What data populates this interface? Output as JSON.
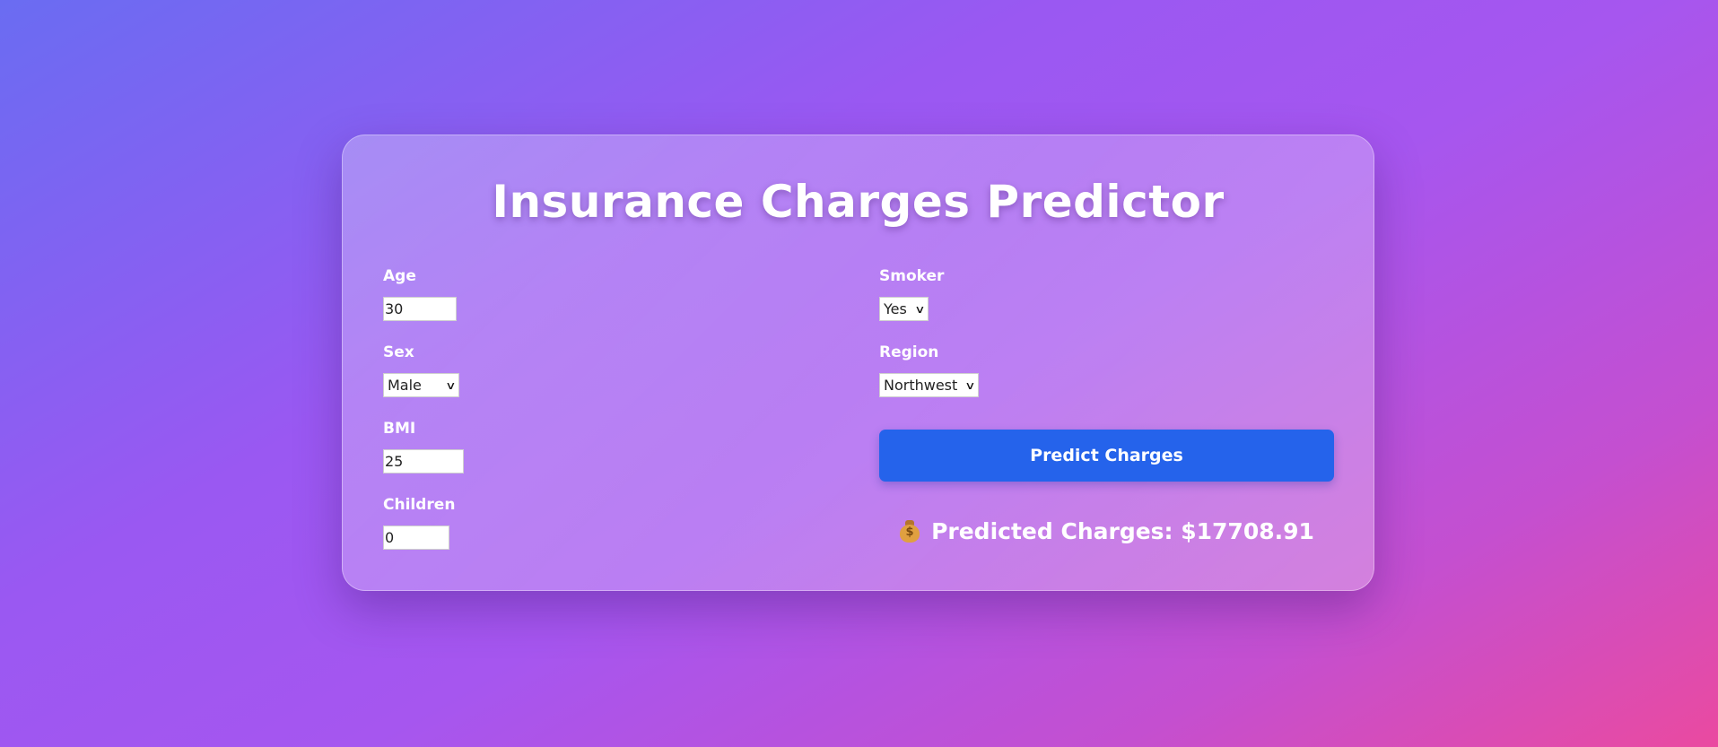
{
  "app": {
    "title": "Insurance Charges Predictor"
  },
  "form": {
    "age": {
      "label": "Age",
      "value": "30"
    },
    "sex": {
      "label": "Sex",
      "value": "Male"
    },
    "bmi": {
      "label": "BMI",
      "value": "25"
    },
    "children": {
      "label": "Children",
      "value": "0"
    },
    "smoker": {
      "label": "Smoker",
      "value": "Yes"
    },
    "region": {
      "label": "Region",
      "value": "Northwest"
    }
  },
  "actions": {
    "predict_label": "Predict Charges"
  },
  "result": {
    "icon": "money-bag-icon",
    "text": "Predicted Charges: $17708.91"
  },
  "colors": {
    "button": "#2563eb",
    "gradient_start": "#6a6cf2",
    "gradient_end": "#ea4aa0"
  }
}
